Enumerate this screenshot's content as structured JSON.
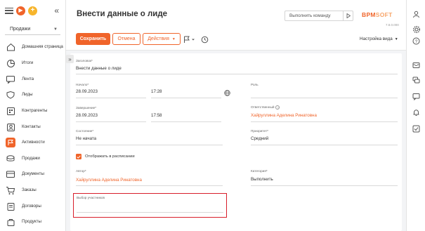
{
  "sidebar": {
    "workplace": "Продажи",
    "items": [
      {
        "label": "Домашняя страница",
        "icon": "home-icon"
      },
      {
        "label": "Итоги",
        "icon": "chart-icon"
      },
      {
        "label": "Лента",
        "icon": "feed-icon"
      },
      {
        "label": "Лиды",
        "icon": "leads-icon"
      },
      {
        "label": "Контрагенты",
        "icon": "accounts-icon"
      },
      {
        "label": "Контакты",
        "icon": "contacts-icon"
      },
      {
        "label": "Активности",
        "icon": "activities-icon"
      },
      {
        "label": "Продажи",
        "icon": "sales-icon"
      },
      {
        "label": "Документы",
        "icon": "documents-icon"
      },
      {
        "label": "Заказы",
        "icon": "orders-icon"
      },
      {
        "label": "Договоры",
        "icon": "contracts-icon"
      },
      {
        "label": "Продукты",
        "icon": "products-icon"
      }
    ],
    "active_index": 6
  },
  "header": {
    "title": "Внести данные о лиде",
    "command_placeholder": "Выполнить команду",
    "logo_main": "BPM",
    "logo_sub": "SOFT",
    "version": "7.8.0.000",
    "save": "Сохранить",
    "cancel": "Отмена",
    "actions": "Действия",
    "view_settings": "Настройка вида"
  },
  "form": {
    "subject": {
      "label": "Заголовок*",
      "value": "Внести данные о лиде"
    },
    "start": {
      "label": "Начало*",
      "date": "28.09.2023",
      "time": "17:28"
    },
    "role": {
      "label": "Роль",
      "value": ""
    },
    "end": {
      "label": "Завершение*",
      "date": "28.09.2023",
      "time": "17:58"
    },
    "owner": {
      "label": "Ответственный",
      "value": "Хайруллина Аделина Ринатовна"
    },
    "status": {
      "label": "Состояние*",
      "value": "Не начата"
    },
    "priority": {
      "label": "Приоритет*",
      "value": "Средний"
    },
    "show_in_schedule": {
      "label": "Отображать в расписании",
      "checked": true
    },
    "author": {
      "label": "Автор*",
      "value": "Хайруллина Аделина Ринатовна"
    },
    "category": {
      "label": "Категория*",
      "value": "Выполнить"
    },
    "participants": {
      "label": "Выбор участников",
      "value": ""
    }
  },
  "colors": {
    "accent": "#f0642a",
    "highlight": "#d81e2b"
  }
}
